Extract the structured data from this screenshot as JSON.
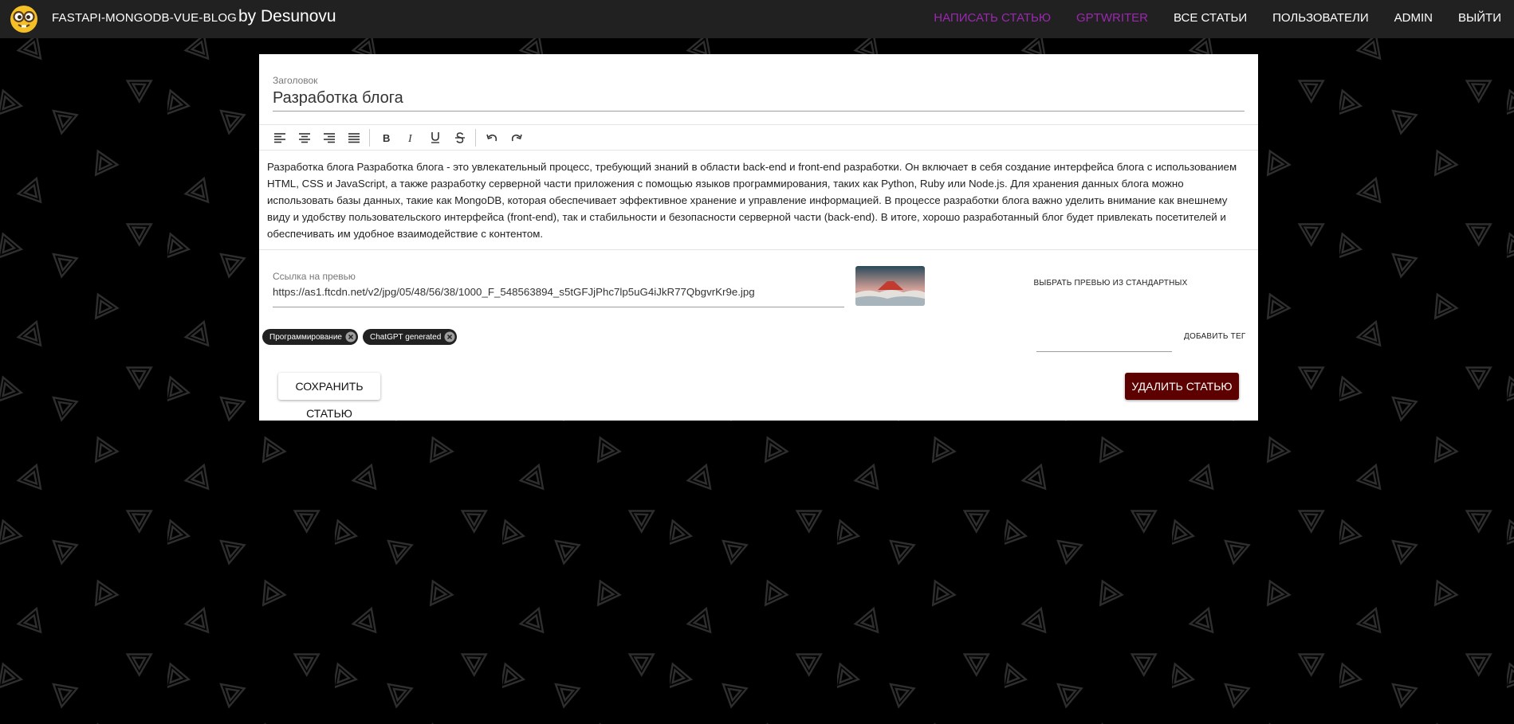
{
  "header": {
    "brand": "FASTAPI-MONGODB-VUE-BLOG",
    "author": "by Desunovu",
    "logo_icon": "nerd-face-emoji-icon",
    "nav": [
      {
        "label": "НАПИСАТЬ СТАТЬЮ",
        "accent": true
      },
      {
        "label": "GPTWRITER",
        "accent": true
      },
      {
        "label": "ВСЕ СТАТЬИ",
        "accent": false
      },
      {
        "label": "ПОЛЬЗОВАТЕЛИ",
        "accent": false
      },
      {
        "label": "ADMIN",
        "accent": false
      },
      {
        "label": "ВЫЙТИ",
        "accent": false
      }
    ]
  },
  "editor": {
    "title_label": "Заголовок",
    "title_value": "Разработка блога",
    "toolbar": [
      "align-left-icon",
      "align-center-icon",
      "align-right-icon",
      "align-justify-icon",
      "bold-icon",
      "italic-icon",
      "underline-icon",
      "strikethrough-icon",
      "undo-icon",
      "redo-icon"
    ],
    "body": "Разработка блога Разработка блога - это увлекательный процесс, требующий знаний в области back-end и front-end разработки. Он включает в себя создание интерфейса блога с использованием HTML, CSS и JavaScript, а также разработку серверной части приложения с помощью языков программирования, таких как Python, Ruby или Node.js. Для хранения данных блога можно использовать базы данных, такие как MongoDB, которая обеспечивает эффективное хранение и управление информацией. В процессе разработки блога важно уделить внимание как внешнему виду и удобству пользовательского интерфейса (front-end), так и стабильности и безопасности серверной части (back-end). В итоге, хорошо разработанный блог будет привлекать посетителей и обеспечивать им удобное взаимодействие с контентом.",
    "preview_label": "Ссылка на превью",
    "preview_value": "https://as1.ftcdn.net/v2/jpg/05/48/56/38/1000_F_548563894_s5tGFJjPhc7lp5uG4iJkR77QbgvrKr9e.jpg",
    "choose_preview": "ВЫБРАТЬ ПРЕВЬЮ ИЗ СТАНДАРТНЫХ",
    "tags": [
      "Программирование",
      "ChatGPT generated"
    ],
    "add_tag": "ДОБАВИТЬ ТЕГ",
    "save": "СОХРАНИТЬ СТАТЬЮ",
    "delete": "УДАЛИТЬ СТАТЬЮ"
  },
  "colors": {
    "appbar": "#212121",
    "accent": "#9c27b0",
    "delete": "#5c0000",
    "background": "#000000"
  }
}
